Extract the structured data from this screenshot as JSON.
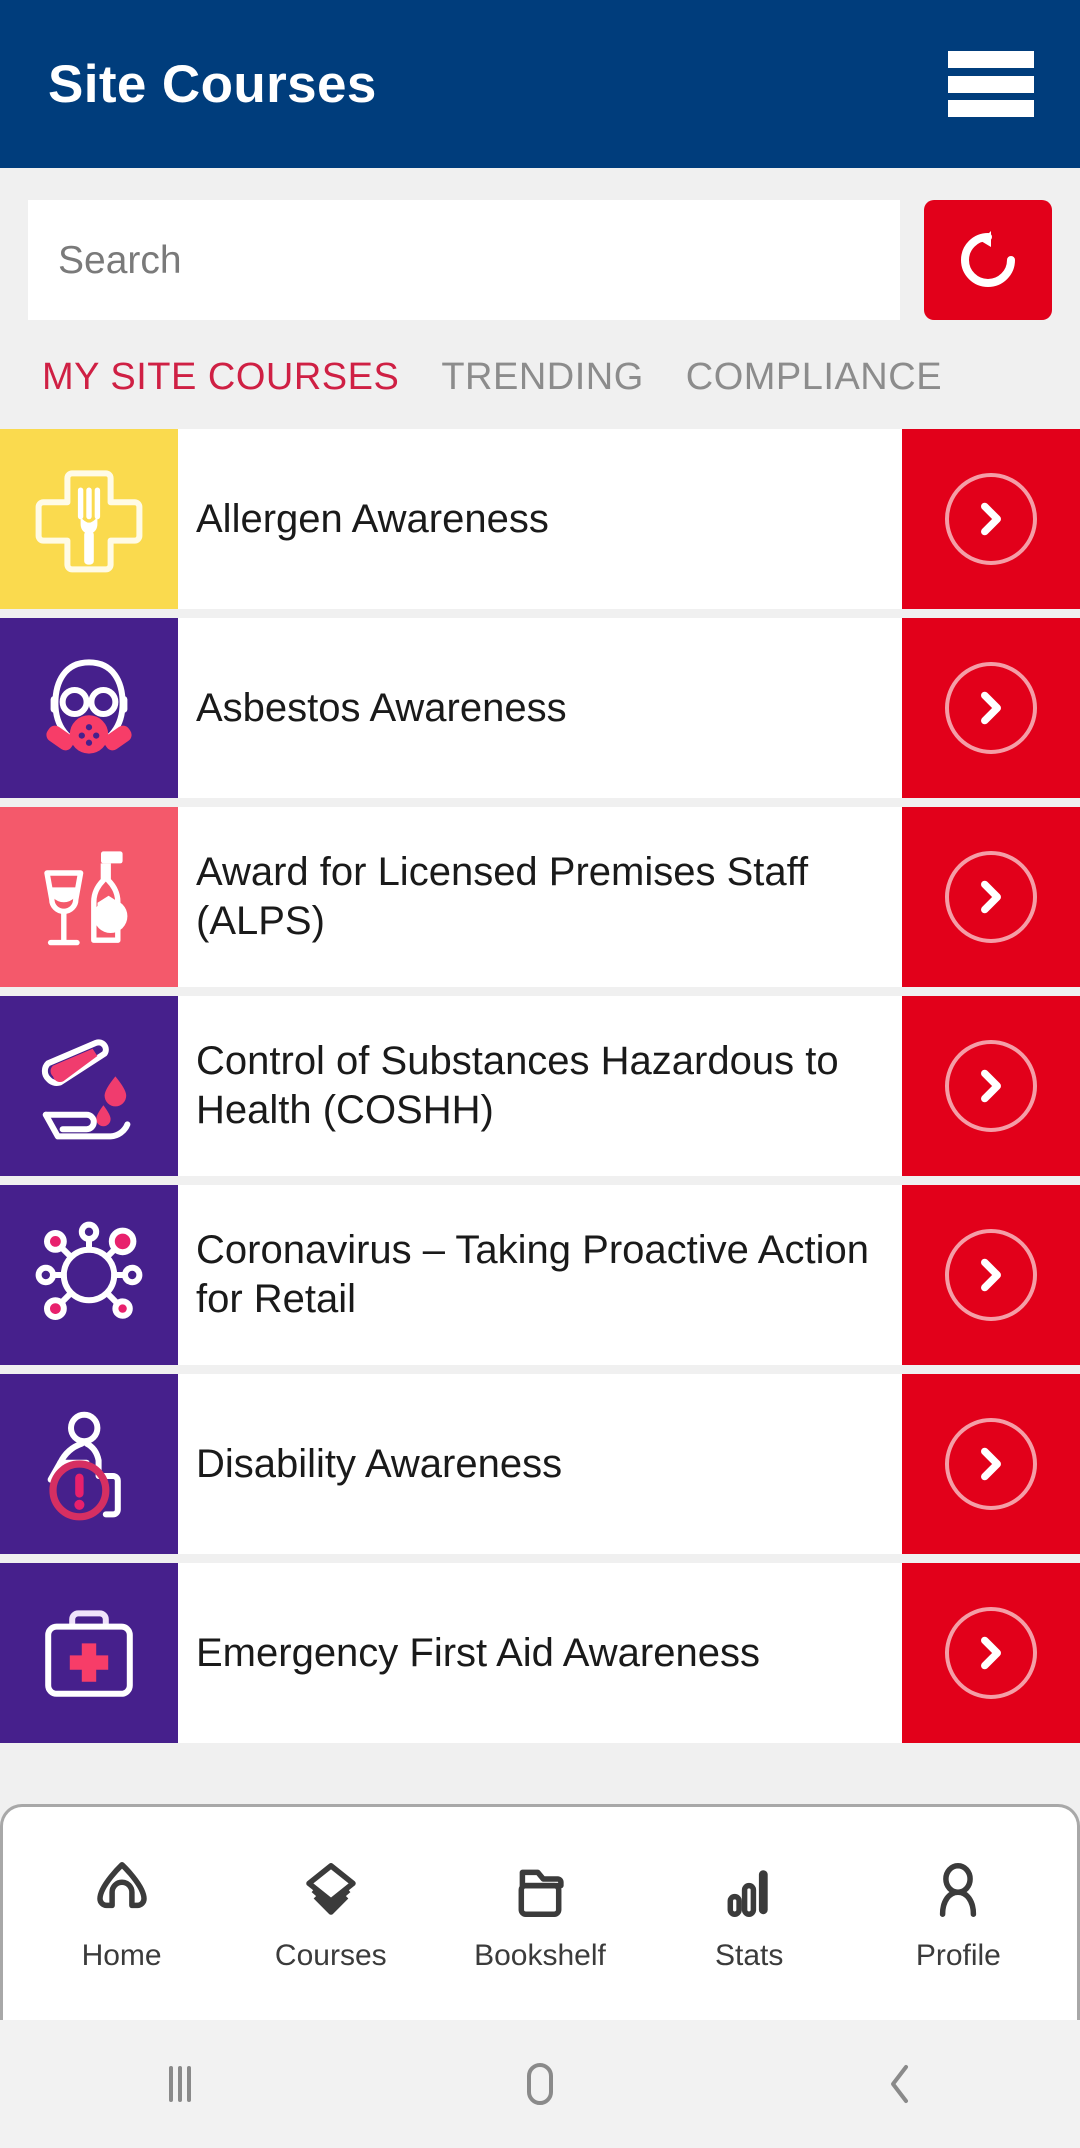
{
  "appbar": {
    "title": "Site Courses",
    "menu_icon": "hamburger-menu-icon"
  },
  "search": {
    "placeholder": "Search",
    "value": "",
    "refresh_icon": "refresh-icon"
  },
  "tabs": [
    {
      "label": "MY SITE COURSES",
      "active": true
    },
    {
      "label": "TRENDING",
      "active": false
    },
    {
      "label": "COMPLIANCE",
      "active": false
    }
  ],
  "colors": {
    "appbar_blue": "#003d7c",
    "accent_red": "#e2001a",
    "tab_active": "#cf2044",
    "tab_inactive": "#8c8c8c",
    "tile_yellow": "#fada4e",
    "tile_purple": "#46208c",
    "tile_coral": "#f4596b",
    "tile_pink": "#f73d68",
    "page_bg": "#f0f0f0"
  },
  "courses": [
    {
      "title": "Allergen Awareness",
      "icon": "fork-in-medical-cross-icon",
      "tile_color": "#fada4e",
      "go_icon": "chevron-right-circle-icon"
    },
    {
      "title": "Asbestos Awareness",
      "icon": "gas-mask-icon",
      "tile_color": "#46208c",
      "go_icon": "chevron-right-circle-icon"
    },
    {
      "title": "Award for Licensed Premises Staff (ALPS)",
      "icon": "wine-glass-bottle-icon",
      "tile_color": "#f4596b",
      "go_icon": "chevron-right-circle-icon"
    },
    {
      "title": "Control of Substances Hazardous to Health (COSHH)",
      "icon": "test-tube-drip-hand-icon",
      "tile_color": "#46208c",
      "go_icon": "chevron-right-circle-icon"
    },
    {
      "title": "Coronavirus – Taking Proactive Action for Retail",
      "icon": "virus-icon",
      "tile_color": "#46208c",
      "go_icon": "chevron-right-circle-icon"
    },
    {
      "title": "Disability Awareness",
      "icon": "wheelchair-alert-icon",
      "tile_color": "#46208c",
      "go_icon": "chevron-right-circle-icon"
    },
    {
      "title": "Emergency First Aid Awareness",
      "icon": "first-aid-kit-icon",
      "tile_color": "#46208c",
      "go_icon": "chevron-right-circle-icon"
    }
  ],
  "bottom_nav": [
    {
      "label": "Home",
      "icon": "home-icon"
    },
    {
      "label": "Courses",
      "icon": "graduation-cap-icon"
    },
    {
      "label": "Bookshelf",
      "icon": "folder-icon"
    },
    {
      "label": "Stats",
      "icon": "bar-chart-icon"
    },
    {
      "label": "Profile",
      "icon": "person-icon"
    }
  ],
  "system_nav": [
    {
      "name": "recents",
      "icon": "recents-bars-icon"
    },
    {
      "name": "home",
      "icon": "home-pill-icon"
    },
    {
      "name": "back",
      "icon": "chevron-left-icon"
    }
  ]
}
